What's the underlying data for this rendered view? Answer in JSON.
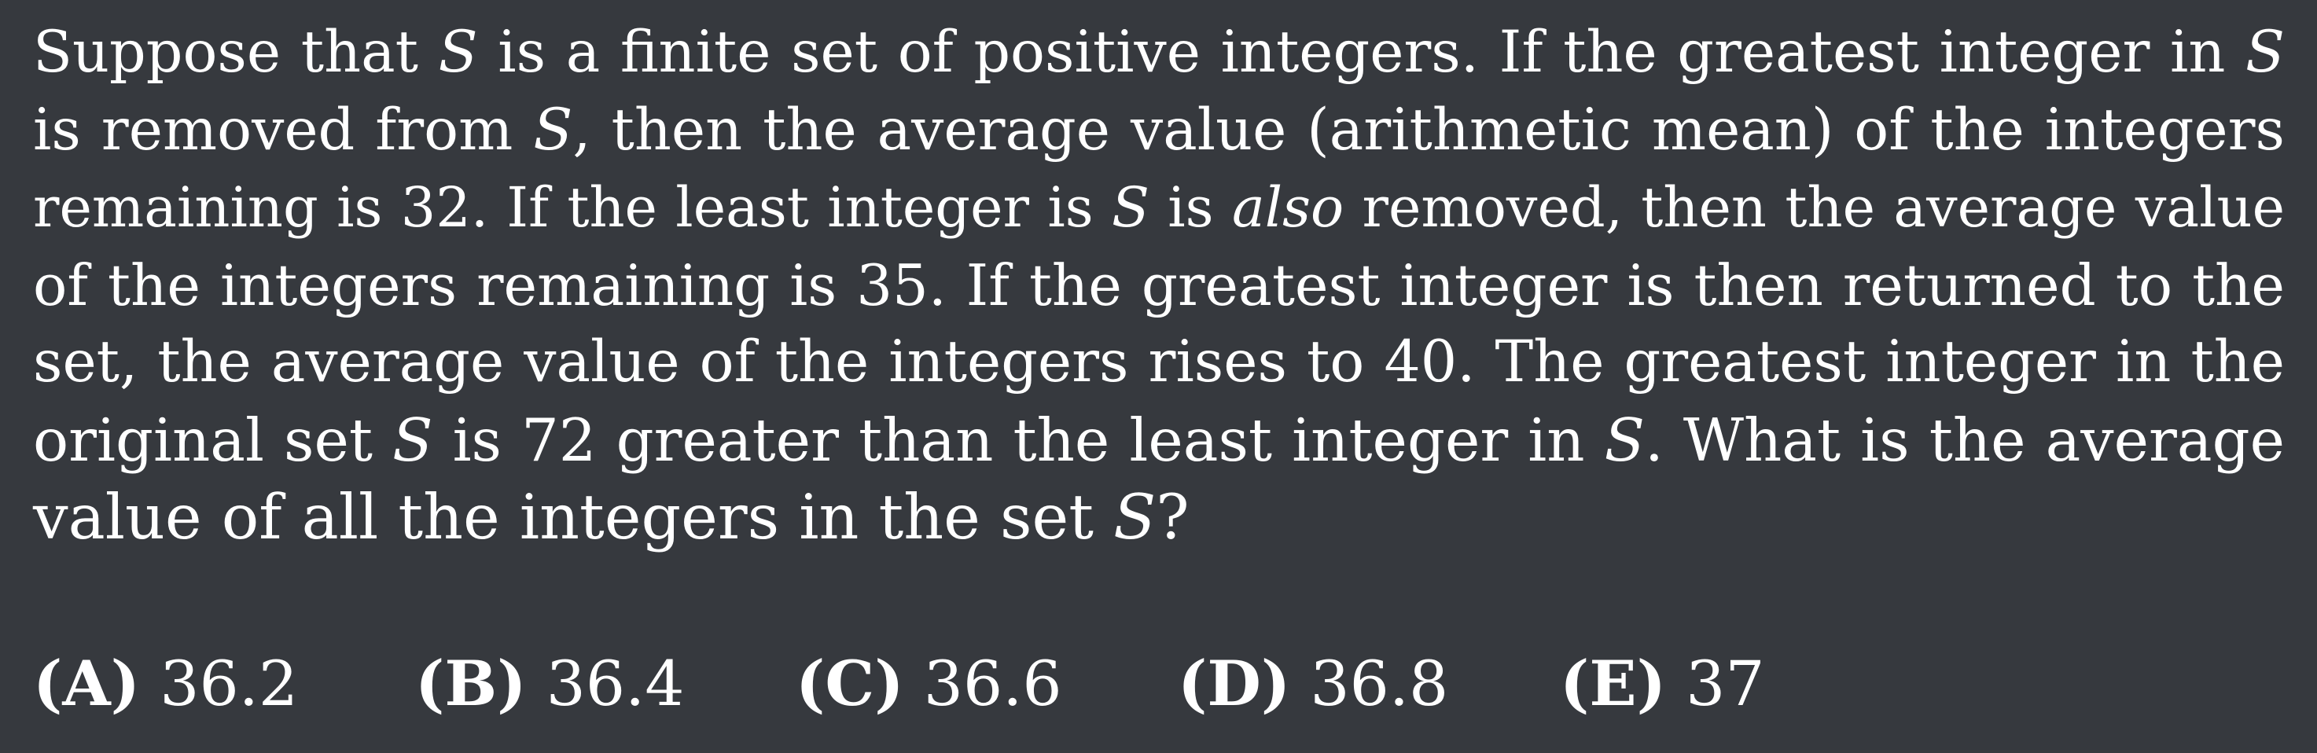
{
  "problem": {
    "lines": [
      [
        {
          "t": "Suppose that ",
          "s": "text"
        },
        {
          "t": "S",
          "s": "var"
        },
        {
          "t": " is a finite set of positive integers.  If the greatest integer in ",
          "s": "text"
        },
        {
          "t": "S",
          "s": "var"
        }
      ],
      [
        {
          "t": "is removed from ",
          "s": "text"
        },
        {
          "t": "S",
          "s": "var"
        },
        {
          "t": ", then the average value (arithmetic mean) of the integers",
          "s": "text"
        }
      ],
      [
        {
          "t": "remaining is 32.  If the least integer is ",
          "s": "text"
        },
        {
          "t": "S",
          "s": "var"
        },
        {
          "t": " is ",
          "s": "text"
        },
        {
          "t": "also",
          "s": "emph"
        },
        {
          "t": " removed, then the average value",
          "s": "text"
        }
      ],
      [
        {
          "t": "of the integers remaining is 35.  If the greatest integer is then returned to the",
          "s": "text"
        }
      ],
      [
        {
          "t": "set, the average value of the integers rises to 40.  The greatest integer in the",
          "s": "text"
        }
      ],
      [
        {
          "t": "original set ",
          "s": "text"
        },
        {
          "t": "S",
          "s": "var"
        },
        {
          "t": " is 72 greater than the least integer in ",
          "s": "text"
        },
        {
          "t": "S",
          "s": "var"
        },
        {
          "t": ".  What is the average",
          "s": "text"
        }
      ],
      [
        {
          "t": "value of all the integers in the set ",
          "s": "text"
        },
        {
          "t": "S",
          "s": "var"
        },
        {
          "t": "?",
          "s": "text"
        }
      ]
    ]
  },
  "choices": [
    {
      "letter": "(A)",
      "value": "36.2"
    },
    {
      "letter": "(B)",
      "value": "36.4"
    },
    {
      "letter": "(C)",
      "value": "36.6"
    },
    {
      "letter": "(D)",
      "value": "36.8"
    },
    {
      "letter": "(E)",
      "value": "37"
    }
  ]
}
